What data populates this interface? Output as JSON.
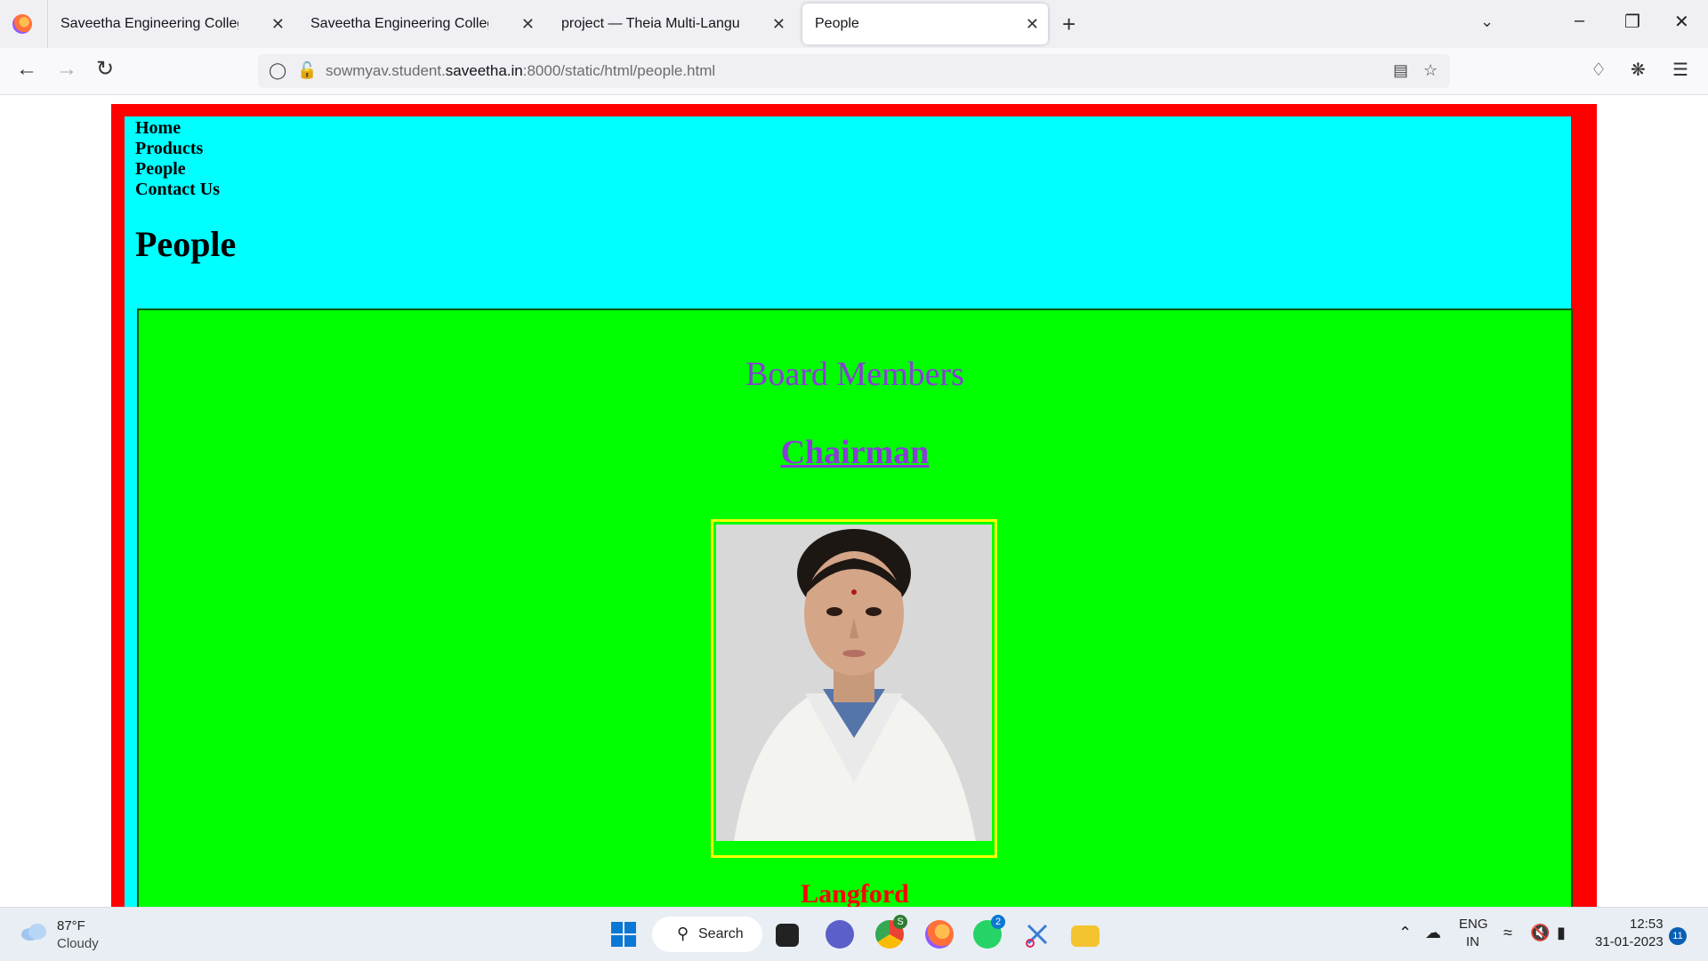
{
  "browser": {
    "tabs": [
      {
        "label": "Saveetha Engineering College",
        "active": false
      },
      {
        "label": "Saveetha Engineering College",
        "active": false
      },
      {
        "label": "project — Theia Multi-Language Ex",
        "active": false
      },
      {
        "label": "People",
        "active": true
      }
    ],
    "url_prefix": "sowmyav.student.",
    "url_domain": "saveetha.in",
    "url_suffix": ":8000/static/html/people.html"
  },
  "page": {
    "nav": [
      "Home",
      "Products",
      "People",
      "Contact Us"
    ],
    "heading": "People",
    "section_title": "Board Members",
    "role_title": "Chairman",
    "member_name": "Langford",
    "colors": {
      "outer": "#ff0000",
      "inner": "#00ffff",
      "content": "#00ff00",
      "title": "#8a3cd8",
      "name": "#ff0000",
      "photo_border": "#ffff00"
    }
  },
  "taskbar": {
    "weather_temp": "87°F",
    "weather_desc": "Cloudy",
    "search_label": "Search",
    "chrome_badge": "S",
    "whatsapp_badge": "2",
    "lang_top": "ENG",
    "lang_bottom": "IN",
    "time": "12:53",
    "date": "31-01-2023",
    "notifications": "11"
  }
}
